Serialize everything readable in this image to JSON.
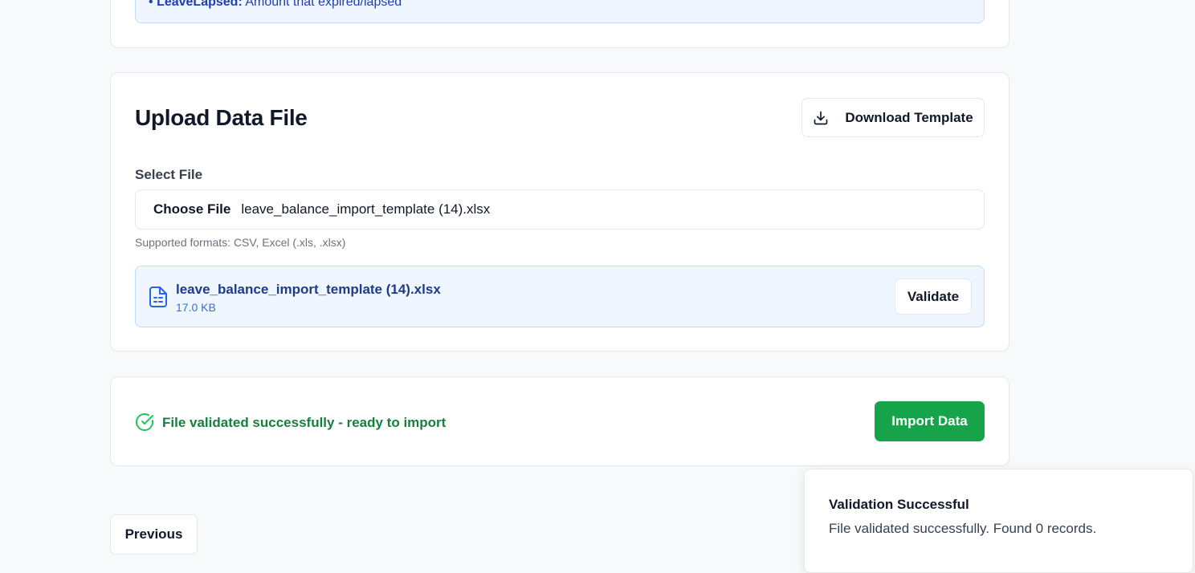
{
  "info_box": {
    "bullet": "•",
    "term": "LeaveLapsed:",
    "description": "Amount that expired/lapsed"
  },
  "upload": {
    "title": "Upload Data File",
    "download_label": "Download Template",
    "download_icon": "download-icon",
    "select_label": "Select File",
    "choose_label": "Choose File",
    "chosen_file": "leave_balance_import_template (14).xlsx",
    "help": "Supported formats: CSV, Excel (.xls, .xlsx)",
    "selected_file": {
      "icon": "file-spreadsheet-icon",
      "name": "leave_balance_import_template (14).xlsx",
      "size": "17.0 KB"
    },
    "validate_label": "Validate"
  },
  "validation": {
    "icon": "check-circle-icon",
    "message": "File validated successfully - ready to import",
    "import_label": "Import Data"
  },
  "nav": {
    "previous_label": "Previous"
  },
  "toast": {
    "title": "Validation Successful",
    "description": "File validated successfully. Found 0 records."
  },
  "colors": {
    "accent_blue": "#1e40af",
    "info_bg": "#eff6ff",
    "success_green": "#16a34a",
    "success_text": "#15803d"
  }
}
